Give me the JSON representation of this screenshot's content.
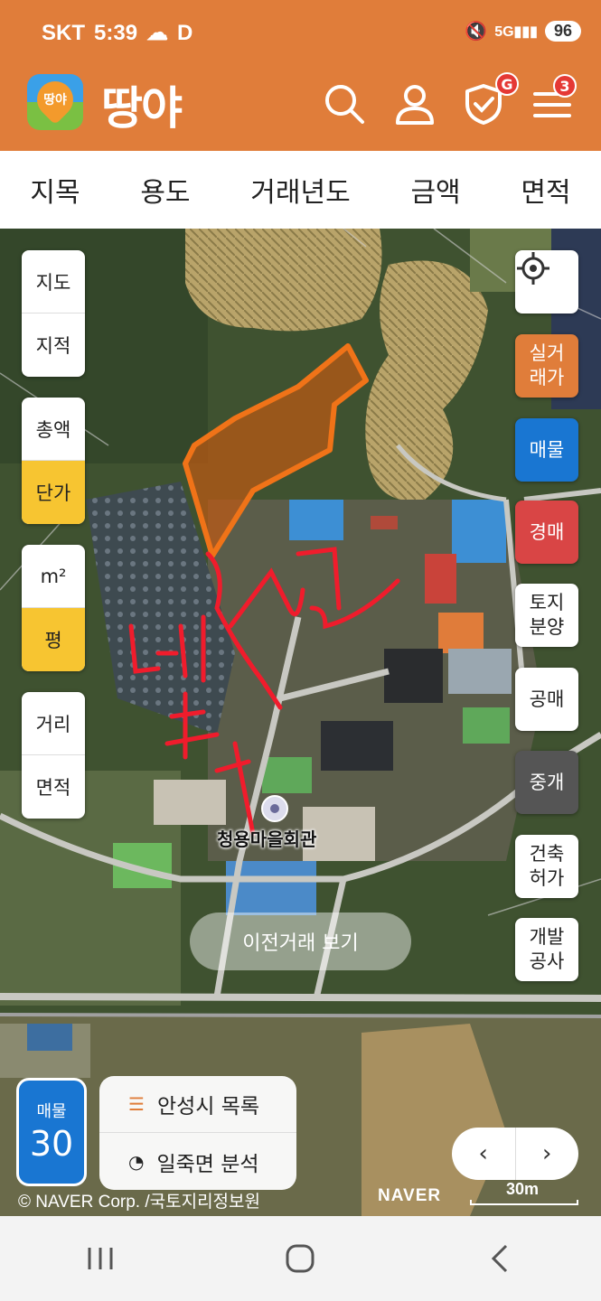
{
  "status_bar": {
    "carrier": "SKT",
    "time": "5:39",
    "battery": "96",
    "extra_icon": "D"
  },
  "header": {
    "logo_text": "땅야",
    "app_name": "땅야",
    "icons": [
      "search-icon",
      "user-icon",
      "shield-check-icon",
      "menu-icon"
    ],
    "shield_badge": "G",
    "menu_badge": "3",
    "accent": "#e07d3a"
  },
  "filters": [
    "지목",
    "용도",
    "거래년도",
    "금액",
    "면적"
  ],
  "left_controls": {
    "group1": [
      "지도",
      "지적"
    ],
    "group2": [
      "총액",
      "단가"
    ],
    "group3": [
      "m²",
      "평"
    ],
    "group4": [
      "거리",
      "면적"
    ]
  },
  "right_controls": {
    "real_price": "실거\n래가",
    "listings": "매물",
    "auction": "경매",
    "land_sale": "토지\n분양",
    "public_sale": "공매",
    "brokerage": "중개",
    "building_permit": "건축\n허가",
    "development": "개발\n공사",
    "colors": {
      "real_price": "#e07d3a",
      "listings": "#1976d2",
      "auction": "#d94545",
      "brokerage": "#555555"
    }
  },
  "map": {
    "place_label": "청용마을회관",
    "prev_trade_button": "이전거래 보기",
    "listing_count_label": "매물",
    "listing_count": "30",
    "list_link": "안성시 목록",
    "analysis_link": "일죽면 분석",
    "copyright": "© NAVER Corp. /국토지리정보원",
    "naver_logo": "NAVER",
    "scale": "30m"
  }
}
